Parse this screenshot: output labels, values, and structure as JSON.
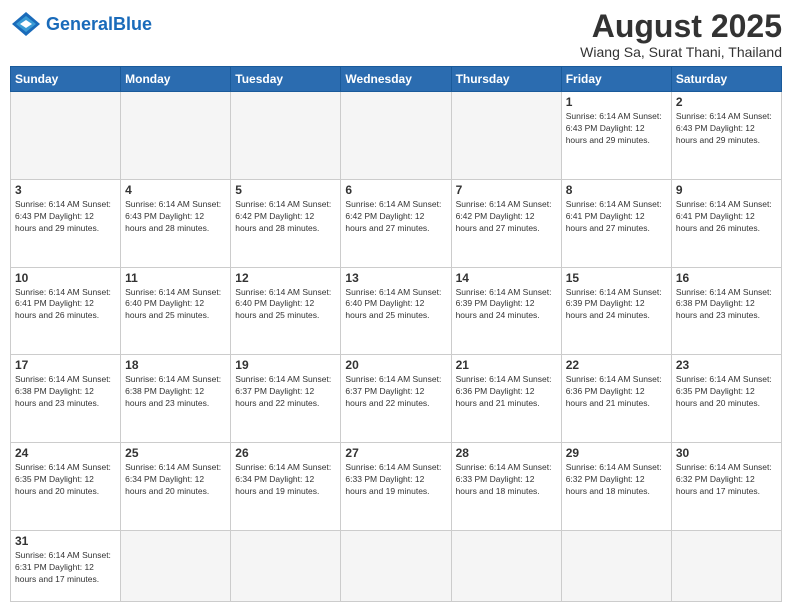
{
  "logo": {
    "text_general": "General",
    "text_blue": "Blue"
  },
  "header": {
    "month_year": "August 2025",
    "location": "Wiang Sa, Surat Thani, Thailand"
  },
  "days_of_week": [
    "Sunday",
    "Monday",
    "Tuesday",
    "Wednesday",
    "Thursday",
    "Friday",
    "Saturday"
  ],
  "weeks": [
    [
      {
        "day": "",
        "info": ""
      },
      {
        "day": "",
        "info": ""
      },
      {
        "day": "",
        "info": ""
      },
      {
        "day": "",
        "info": ""
      },
      {
        "day": "",
        "info": ""
      },
      {
        "day": "1",
        "info": "Sunrise: 6:14 AM\nSunset: 6:43 PM\nDaylight: 12 hours\nand 29 minutes."
      },
      {
        "day": "2",
        "info": "Sunrise: 6:14 AM\nSunset: 6:43 PM\nDaylight: 12 hours\nand 29 minutes."
      }
    ],
    [
      {
        "day": "3",
        "info": "Sunrise: 6:14 AM\nSunset: 6:43 PM\nDaylight: 12 hours\nand 29 minutes."
      },
      {
        "day": "4",
        "info": "Sunrise: 6:14 AM\nSunset: 6:43 PM\nDaylight: 12 hours\nand 28 minutes."
      },
      {
        "day": "5",
        "info": "Sunrise: 6:14 AM\nSunset: 6:42 PM\nDaylight: 12 hours\nand 28 minutes."
      },
      {
        "day": "6",
        "info": "Sunrise: 6:14 AM\nSunset: 6:42 PM\nDaylight: 12 hours\nand 27 minutes."
      },
      {
        "day": "7",
        "info": "Sunrise: 6:14 AM\nSunset: 6:42 PM\nDaylight: 12 hours\nand 27 minutes."
      },
      {
        "day": "8",
        "info": "Sunrise: 6:14 AM\nSunset: 6:41 PM\nDaylight: 12 hours\nand 27 minutes."
      },
      {
        "day": "9",
        "info": "Sunrise: 6:14 AM\nSunset: 6:41 PM\nDaylight: 12 hours\nand 26 minutes."
      }
    ],
    [
      {
        "day": "10",
        "info": "Sunrise: 6:14 AM\nSunset: 6:41 PM\nDaylight: 12 hours\nand 26 minutes."
      },
      {
        "day": "11",
        "info": "Sunrise: 6:14 AM\nSunset: 6:40 PM\nDaylight: 12 hours\nand 25 minutes."
      },
      {
        "day": "12",
        "info": "Sunrise: 6:14 AM\nSunset: 6:40 PM\nDaylight: 12 hours\nand 25 minutes."
      },
      {
        "day": "13",
        "info": "Sunrise: 6:14 AM\nSunset: 6:40 PM\nDaylight: 12 hours\nand 25 minutes."
      },
      {
        "day": "14",
        "info": "Sunrise: 6:14 AM\nSunset: 6:39 PM\nDaylight: 12 hours\nand 24 minutes."
      },
      {
        "day": "15",
        "info": "Sunrise: 6:14 AM\nSunset: 6:39 PM\nDaylight: 12 hours\nand 24 minutes."
      },
      {
        "day": "16",
        "info": "Sunrise: 6:14 AM\nSunset: 6:38 PM\nDaylight: 12 hours\nand 23 minutes."
      }
    ],
    [
      {
        "day": "17",
        "info": "Sunrise: 6:14 AM\nSunset: 6:38 PM\nDaylight: 12 hours\nand 23 minutes."
      },
      {
        "day": "18",
        "info": "Sunrise: 6:14 AM\nSunset: 6:38 PM\nDaylight: 12 hours\nand 23 minutes."
      },
      {
        "day": "19",
        "info": "Sunrise: 6:14 AM\nSunset: 6:37 PM\nDaylight: 12 hours\nand 22 minutes."
      },
      {
        "day": "20",
        "info": "Sunrise: 6:14 AM\nSunset: 6:37 PM\nDaylight: 12 hours\nand 22 minutes."
      },
      {
        "day": "21",
        "info": "Sunrise: 6:14 AM\nSunset: 6:36 PM\nDaylight: 12 hours\nand 21 minutes."
      },
      {
        "day": "22",
        "info": "Sunrise: 6:14 AM\nSunset: 6:36 PM\nDaylight: 12 hours\nand 21 minutes."
      },
      {
        "day": "23",
        "info": "Sunrise: 6:14 AM\nSunset: 6:35 PM\nDaylight: 12 hours\nand 20 minutes."
      }
    ],
    [
      {
        "day": "24",
        "info": "Sunrise: 6:14 AM\nSunset: 6:35 PM\nDaylight: 12 hours\nand 20 minutes."
      },
      {
        "day": "25",
        "info": "Sunrise: 6:14 AM\nSunset: 6:34 PM\nDaylight: 12 hours\nand 20 minutes."
      },
      {
        "day": "26",
        "info": "Sunrise: 6:14 AM\nSunset: 6:34 PM\nDaylight: 12 hours\nand 19 minutes."
      },
      {
        "day": "27",
        "info": "Sunrise: 6:14 AM\nSunset: 6:33 PM\nDaylight: 12 hours\nand 19 minutes."
      },
      {
        "day": "28",
        "info": "Sunrise: 6:14 AM\nSunset: 6:33 PM\nDaylight: 12 hours\nand 18 minutes."
      },
      {
        "day": "29",
        "info": "Sunrise: 6:14 AM\nSunset: 6:32 PM\nDaylight: 12 hours\nand 18 minutes."
      },
      {
        "day": "30",
        "info": "Sunrise: 6:14 AM\nSunset: 6:32 PM\nDaylight: 12 hours\nand 17 minutes."
      }
    ],
    [
      {
        "day": "31",
        "info": "Sunrise: 6:14 AM\nSunset: 6:31 PM\nDaylight: 12 hours\nand 17 minutes."
      },
      {
        "day": "",
        "info": ""
      },
      {
        "day": "",
        "info": ""
      },
      {
        "day": "",
        "info": ""
      },
      {
        "day": "",
        "info": ""
      },
      {
        "day": "",
        "info": ""
      },
      {
        "day": "",
        "info": ""
      }
    ]
  ]
}
